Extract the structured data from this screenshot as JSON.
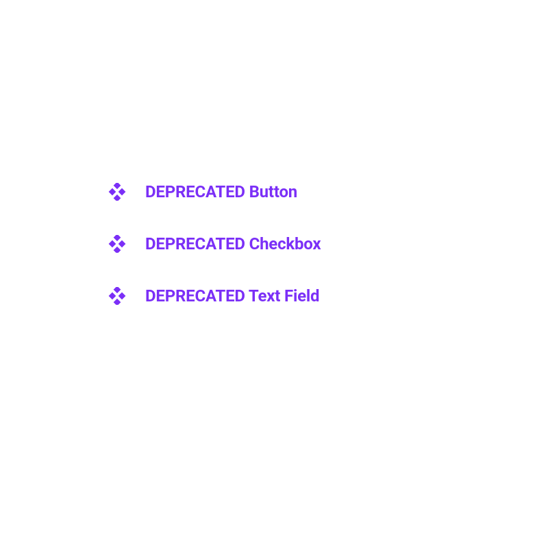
{
  "components": {
    "items": [
      {
        "label": "DEPRECATED Button"
      },
      {
        "label": "DEPRECATED Checkbox"
      },
      {
        "label": "DEPRECATED Text Field"
      }
    ]
  },
  "brand_color": "#7b2ff7"
}
